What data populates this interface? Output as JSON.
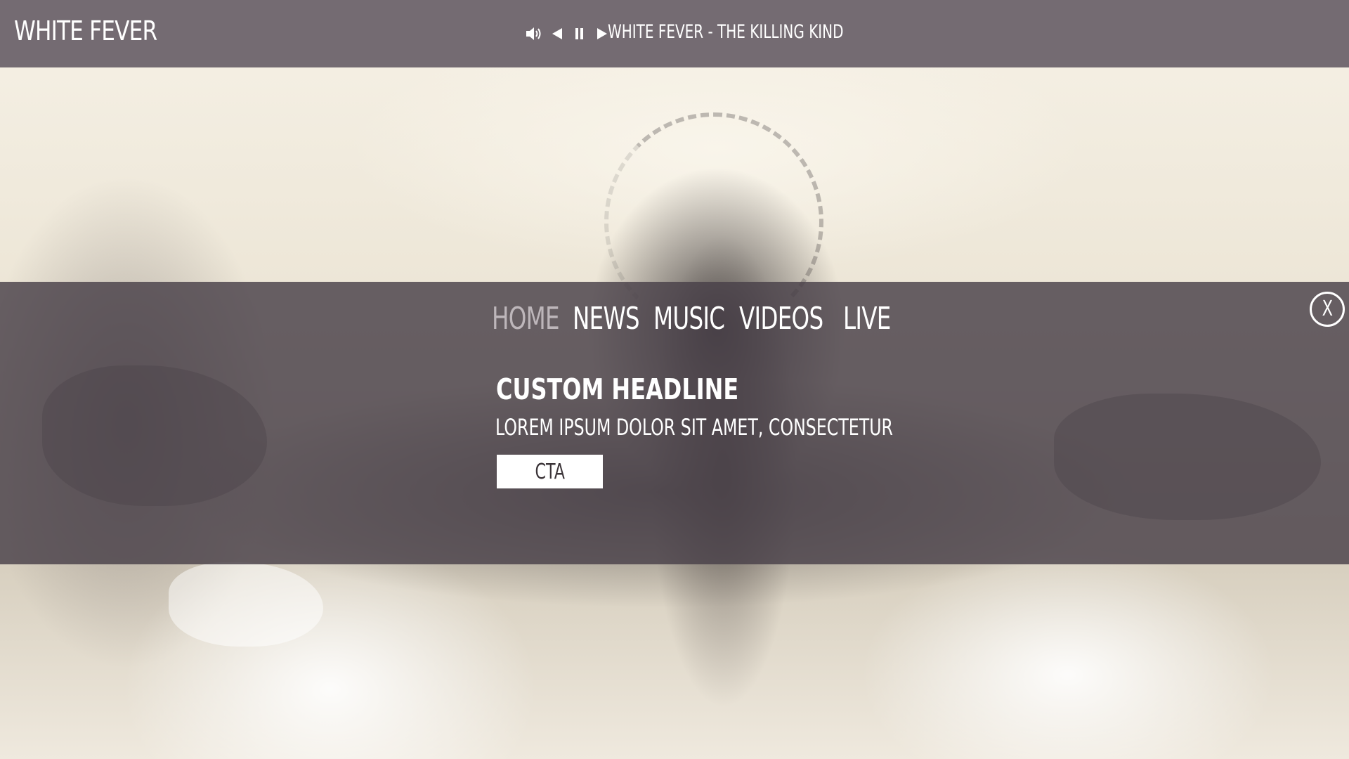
{
  "header": {
    "brand": "WHITE FEVER",
    "now_playing": "WHITE FEVER - THE KILLING KIND",
    "player_controls": [
      {
        "name": "volume",
        "icon": "speaker-volume-icon"
      },
      {
        "name": "previous",
        "icon": "previous-triangle-icon"
      },
      {
        "name": "pause",
        "icon": "pause-icon"
      },
      {
        "name": "play",
        "icon": "play-triangle-icon"
      }
    ]
  },
  "menu": {
    "close_label": "X",
    "items": [
      {
        "label": "HOME",
        "active": true
      },
      {
        "label": "NEWS",
        "active": false
      },
      {
        "label": "MUSIC",
        "active": false
      },
      {
        "label": "VIDEOS",
        "active": false
      },
      {
        "label": "LIVE",
        "active": false
      }
    ]
  },
  "promo": {
    "headline": "CUSTOM HEADLINE",
    "subline": "LOREM IPSUM DOLOR SIT AMET, CONSECTETUR",
    "cta_label": "CTA"
  },
  "colors": {
    "topbar": "#686068",
    "overlay": "#484048",
    "text": "#ffffff",
    "active_nav": "#bdb6ba",
    "cta_bg": "#ffffff",
    "cta_text": "#3b3438"
  }
}
